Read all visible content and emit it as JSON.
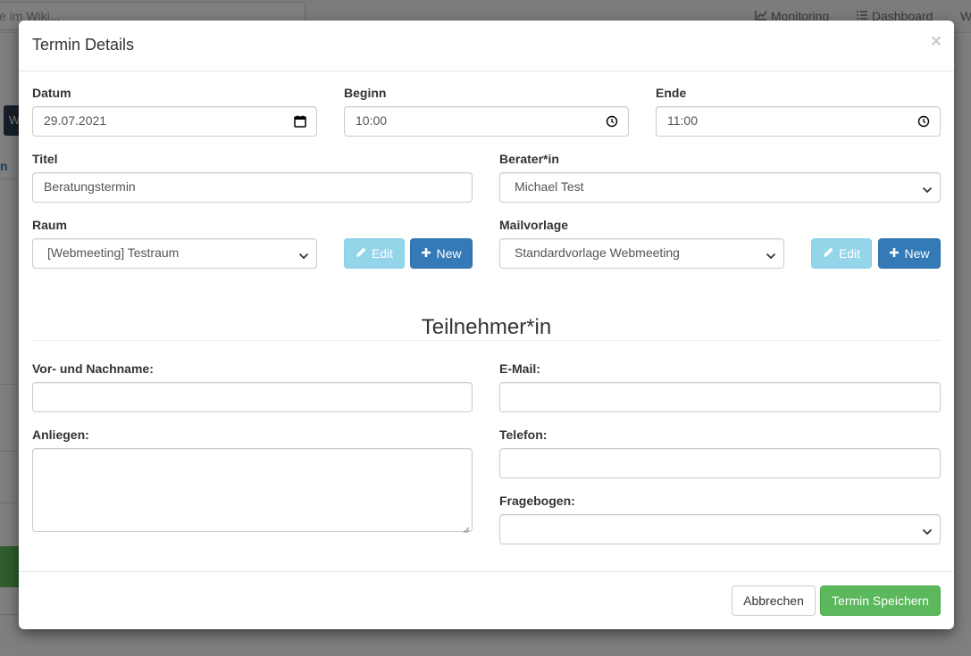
{
  "background": {
    "search_text": "e im Wiki...",
    "nav_monitoring": "Monitoring",
    "nav_dashboard": "Dashboard",
    "nav_more": "W",
    "side_button_text": "W",
    "side_text": "n"
  },
  "modal": {
    "title": "Termin Details",
    "close_label": "×"
  },
  "form": {
    "datum": {
      "label": "Datum",
      "value": "29.07.2021"
    },
    "beginn": {
      "label": "Beginn",
      "value": "10:00"
    },
    "ende": {
      "label": "Ende",
      "value": "11:00"
    },
    "titel": {
      "label": "Titel",
      "value": "Beratungstermin"
    },
    "berater": {
      "label": "Berater*in",
      "value": "Michael Test"
    },
    "raum": {
      "label": "Raum",
      "value": "[Webmeeting] Testraum",
      "edit_label": "Edit",
      "new_label": "New"
    },
    "mailvorlage": {
      "label": "Mailvorlage",
      "value": "Standardvorlage Webmeeting",
      "edit_label": "Edit",
      "new_label": "New"
    }
  },
  "participant": {
    "section_title": "Teilnehmer*in",
    "name": {
      "label": "Vor- und Nachname:",
      "value": ""
    },
    "email": {
      "label": "E-Mail:",
      "value": ""
    },
    "anliegen": {
      "label": "Anliegen:",
      "value": ""
    },
    "telefon": {
      "label": "Telefon:",
      "value": ""
    },
    "fragebogen": {
      "label": "Fragebogen:",
      "value": ""
    }
  },
  "footer": {
    "cancel_label": "Abbrechen",
    "save_label": "Termin Speichern"
  },
  "icons": {
    "calendar": "calendar-icon",
    "clock": "clock-icon",
    "pencil": "pencil-icon",
    "plus": "plus-icon",
    "chevron": "chevron-down-icon"
  },
  "colors": {
    "info": "#5bc0de",
    "primary": "#337ab7",
    "success": "#5cb85c"
  }
}
